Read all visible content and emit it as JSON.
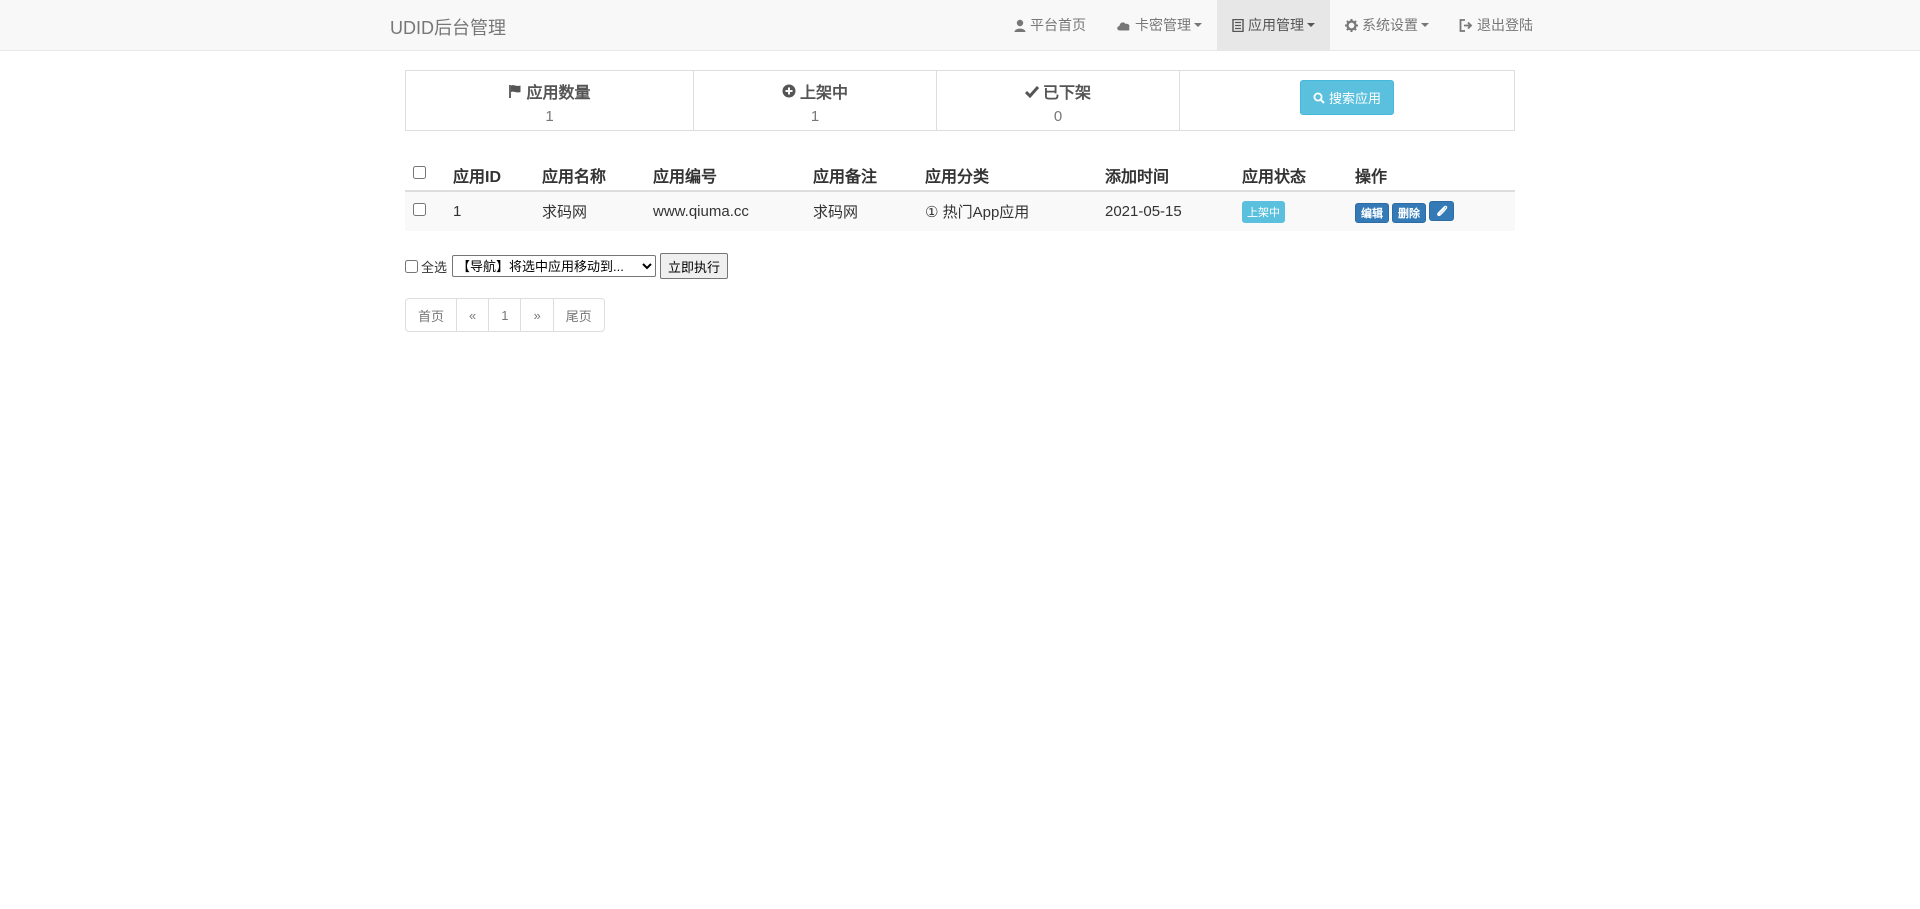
{
  "navbar": {
    "brand": "UDID后台管理",
    "items": [
      {
        "label": "平台首页",
        "icon": "user-icon",
        "dropdown": false
      },
      {
        "label": "卡密管理",
        "icon": "cloud-icon",
        "dropdown": true
      },
      {
        "label": "应用管理",
        "icon": "book-icon",
        "dropdown": true,
        "active": true
      },
      {
        "label": "系统设置",
        "icon": "gear-icon",
        "dropdown": true
      },
      {
        "label": "退出登陆",
        "icon": "logout-icon",
        "dropdown": false
      }
    ]
  },
  "stats": {
    "app_count": {
      "label": "应用数量",
      "value": "1",
      "icon": "flag-icon"
    },
    "listed": {
      "label": "上架中",
      "value": "1",
      "icon": "plus-circle-icon"
    },
    "delisted": {
      "label": "已下架",
      "value": "0",
      "icon": "check-icon"
    },
    "search_button": "搜索应用"
  },
  "table": {
    "headers": [
      "应用ID",
      "应用名称",
      "应用编号",
      "应用备注",
      "应用分类",
      "添加时间",
      "应用状态",
      "操作"
    ],
    "rows": [
      {
        "id": "1",
        "name": "求码网",
        "code": "www.qiuma.cc",
        "note": "求码网",
        "category": "① 热门App应用",
        "added": "2021-05-15",
        "status": "上架中",
        "edit": "编辑",
        "delete": "删除"
      }
    ]
  },
  "batch": {
    "select_all": "全选",
    "move_option": "【导航】将选中应用移动到...",
    "execute": "立即执行"
  },
  "pagination": {
    "first": "首页",
    "prev": "«",
    "page": "1",
    "next": "»",
    "last": "尾页"
  },
  "colors": {
    "navbar_bg": "#f8f8f8",
    "info": "#5bc0de",
    "primary": "#337ab7"
  }
}
